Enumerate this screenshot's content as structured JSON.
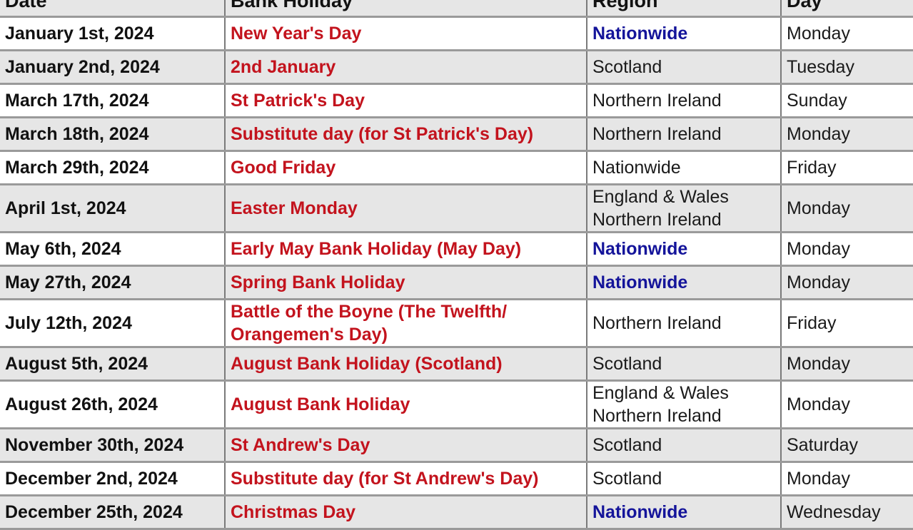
{
  "table": {
    "headers": [
      "Date",
      "Bank Holiday",
      "Region",
      "Day"
    ],
    "colors": {
      "holiday": "#c3131d",
      "nationwide": "#14149a",
      "text": "#111111",
      "stripe": "#e6e6e6"
    },
    "rows": [
      {
        "date": "January 1st, 2024",
        "holiday": "New Year's Day",
        "region": "Nationwide",
        "day": "Monday"
      },
      {
        "date": "January 2nd, 2024",
        "holiday": "2nd January",
        "region": "Scotland",
        "day": "Tuesday"
      },
      {
        "date": "March 17th, 2024",
        "holiday": "St Patrick's Day",
        "region": "Northern Ireland",
        "day": "Sunday"
      },
      {
        "date": "March 18th, 2024",
        "holiday": "Substitute day (for St Patrick's Day)",
        "region": "Northern Ireland",
        "day": "Monday"
      },
      {
        "date": "March 29th, 2024",
        "holiday": "Good Friday",
        "region": "Nationwide",
        "region_style": "plain",
        "day": "Friday"
      },
      {
        "date": "April 1st, 2024",
        "holiday": "Easter Monday",
        "region": "England & Wales Northern Ireland",
        "day": "Monday"
      },
      {
        "date": "May 6th, 2024",
        "holiday": "Early May Bank Holiday (May Day)",
        "region": "Nationwide",
        "day": "Monday"
      },
      {
        "date": "May 27th, 2024",
        "holiday": "Spring Bank Holiday",
        "region": "Nationwide",
        "day": "Monday"
      },
      {
        "date": "July 12th, 2024",
        "holiday": "Battle of the Boyne (The Twelfth/ Orangemen's Day)",
        "region": "Northern Ireland",
        "day": "Friday"
      },
      {
        "date": "August 5th, 2024",
        "holiday": "August Bank Holiday (Scotland)",
        "region": "Scotland",
        "day": "Monday"
      },
      {
        "date": "August 26th, 2024",
        "holiday": "August Bank Holiday",
        "region": "England & Wales Northern Ireland",
        "day": "Monday"
      },
      {
        "date": "November 30th, 2024",
        "holiday": "St Andrew's Day",
        "region": "Scotland",
        "day": "Saturday"
      },
      {
        "date": "December 2nd, 2024",
        "holiday": "Substitute day (for St Andrew's Day)",
        "region": "Scotland",
        "day": "Monday"
      },
      {
        "date": "December 25th, 2024",
        "holiday": "Christmas Day",
        "region": "Nationwide",
        "day": "Wednesday"
      }
    ]
  }
}
